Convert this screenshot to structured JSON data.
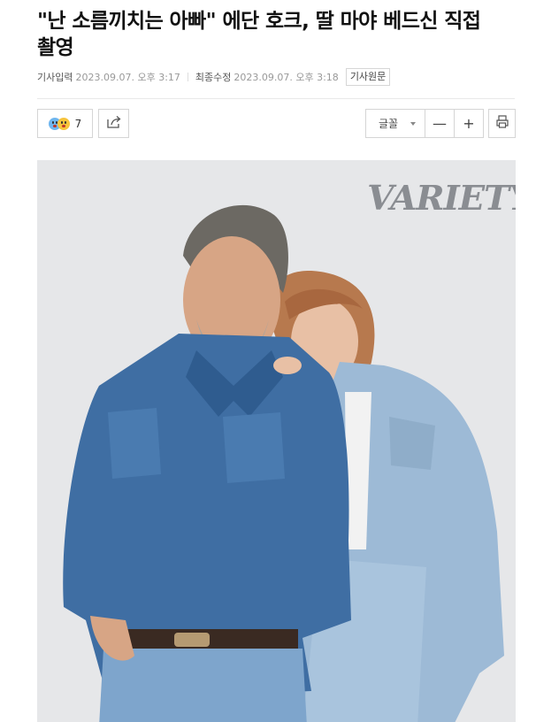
{
  "article": {
    "title": "\"난 소름끼치는 아빠\" 에단 호크, 딸 마야 베드신 직접 촬영",
    "input_label": "기사입력",
    "input_time": "2023.09.07. 오후 3:17",
    "modified_label": "최종수정",
    "modified_time": "2023.09.07. 오후 3:18",
    "original_label": "기사원문"
  },
  "toolbar": {
    "reaction_count": "7",
    "share_icon": "share-icon",
    "font_label": "글꼴",
    "decrease_label": "—",
    "increase_label": "+",
    "print_icon": "print-icon"
  },
  "photo": {
    "logo_text": "VARIETY",
    "background": "#e6e7e9",
    "denim_dark": "#3f6ea3",
    "denim_light": "#9dbad6"
  }
}
